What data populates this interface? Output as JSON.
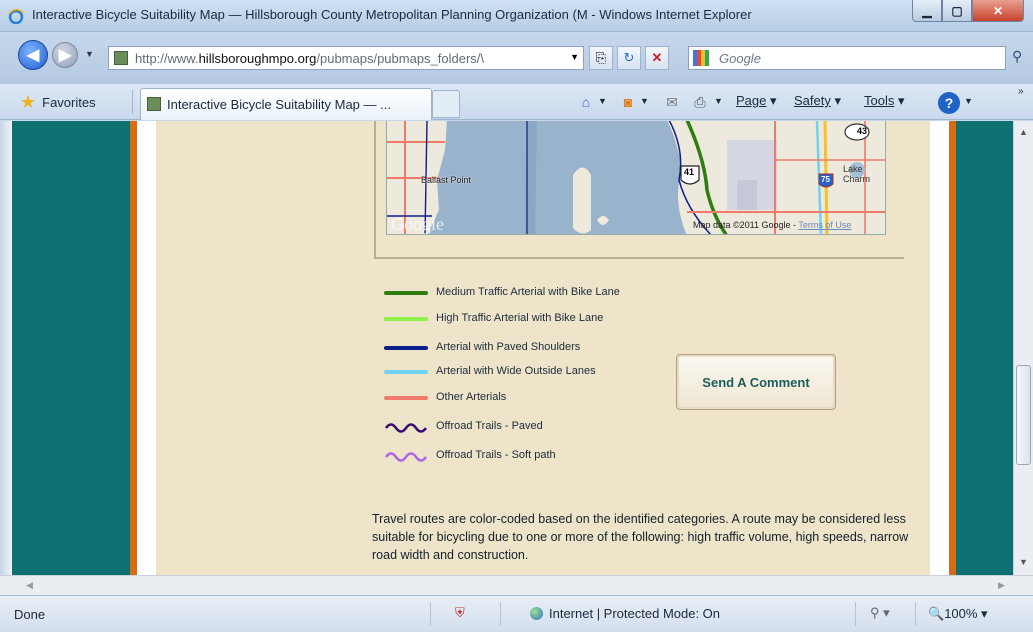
{
  "window": {
    "title": "Interactive Bicycle Suitability Map — Hillsborough County Metropolitan Planning Organization (M - Windows Internet Explorer"
  },
  "address_bar": {
    "url_prefix": "http://www.",
    "url_domain": "hillsboroughmpo.org",
    "url_path": "/pubmaps/pubmaps_folders/\\",
    "search_placeholder": "Google"
  },
  "favorites_bar": {
    "favorites_label": "Favorites",
    "tab_label": "Interactive Bicycle Suitability Map — ...",
    "page_menu": "Page",
    "safety_menu": "Safety",
    "tools_menu": "Tools"
  },
  "map": {
    "labels": {
      "ballast_point": "Ballast Point",
      "lake_charm": "Lake Charm",
      "google_logo": "Google",
      "attribution": "Map data ©2011 Google -",
      "terms": "Terms of Use",
      "route_43": "43",
      "route_41": "41",
      "route_75": "75"
    }
  },
  "legend": [
    {
      "label": "Medium Traffic Arterial with Bike Lane",
      "color": "#2f7d10",
      "style": "solid"
    },
    {
      "label": "High Traffic Arterial with Bike Lane",
      "color": "#8ef04a",
      "style": "solid"
    },
    {
      "label": "Arterial with Paved Shoulders",
      "color": "#0d1f8a",
      "style": "solid"
    },
    {
      "label": "Arterial with Wide Outside Lanes",
      "color": "#6fd3f0",
      "style": "solid"
    },
    {
      "label": "Other Arterials",
      "color": "#f07a6a",
      "style": "solid"
    },
    {
      "label": "Offroad Trails - Paved",
      "color": "#3b0a6e",
      "style": "wavy"
    },
    {
      "label": "Offroad Trails - Soft path",
      "color": "#b064e6",
      "style": "wavy"
    }
  ],
  "send_comment_label": "Send A Comment",
  "description": "Travel routes are color-coded based on the identified categories. A route may be considered less suitable for bicycling due to one or more of the following: high traffic volume, high speeds, narrow road width and construction.",
  "status_bar": {
    "status": "Done",
    "zone": "Internet | Protected Mode: On",
    "zoom": "100%"
  }
}
